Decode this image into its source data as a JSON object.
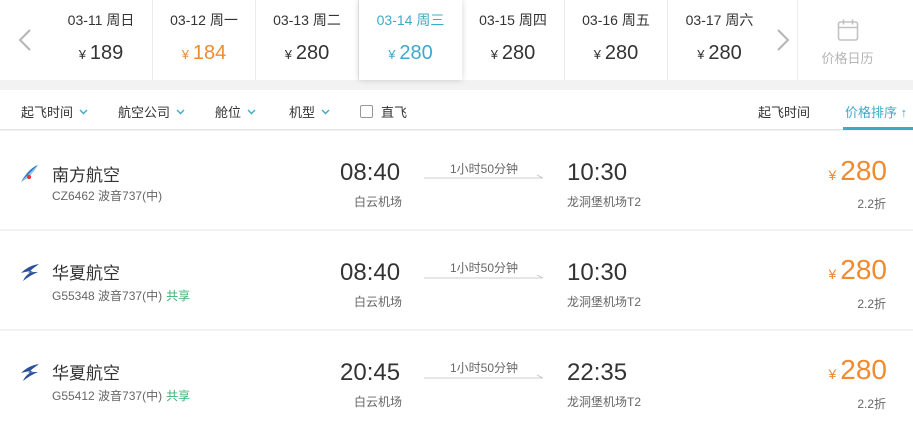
{
  "dates": [
    {
      "label": "03-11 周日",
      "price": "189",
      "state": "normal"
    },
    {
      "label": "03-12 周一",
      "price": "184",
      "state": "cheap"
    },
    {
      "label": "03-13 周二",
      "price": "280",
      "state": "normal"
    },
    {
      "label": "03-14 周三",
      "price": "280",
      "state": "active"
    },
    {
      "label": "03-15 周四",
      "price": "280",
      "state": "normal"
    },
    {
      "label": "03-16 周五",
      "price": "280",
      "state": "normal"
    },
    {
      "label": "03-17 周六",
      "price": "280",
      "state": "normal"
    }
  ],
  "currency": "¥",
  "calendar_label": "价格日历",
  "filters": {
    "dep_time": "起飞时间",
    "airline": "航空公司",
    "cabin": "舱位",
    "plane": "机型",
    "direct": "直飞",
    "sort_time": "起飞时间",
    "sort_price": "价格排序 ↑"
  },
  "flights": [
    {
      "airline": "南方航空",
      "code": "CZ6462",
      "plane": "波音737(中)",
      "shared": "",
      "dep_time": "08:40",
      "dep_airport": "白云机场",
      "duration": "1小时50分钟",
      "arr_time": "10:30",
      "arr_airport": "龙洞堡机场T2",
      "price": "280",
      "discount": "2.2折",
      "logo": "china-southern"
    },
    {
      "airline": "华夏航空",
      "code": "G55348",
      "plane": "波音737(中)",
      "shared": "共享",
      "dep_time": "08:40",
      "dep_airport": "白云机场",
      "duration": "1小时50分钟",
      "arr_time": "10:30",
      "arr_airport": "龙洞堡机场T2",
      "price": "280",
      "discount": "2.2折",
      "logo": "china-express"
    },
    {
      "airline": "华夏航空",
      "code": "G55412",
      "plane": "波音737(中)",
      "shared": "共享",
      "dep_time": "20:45",
      "dep_airport": "白云机场",
      "duration": "1小时50分钟",
      "arr_time": "22:35",
      "arr_airport": "龙洞堡机场T2",
      "price": "280",
      "discount": "2.2折",
      "logo": "china-express"
    }
  ],
  "colors": {
    "accent": "#3fa9c9",
    "price": "#f08a2f",
    "shared": "#3cb371"
  }
}
